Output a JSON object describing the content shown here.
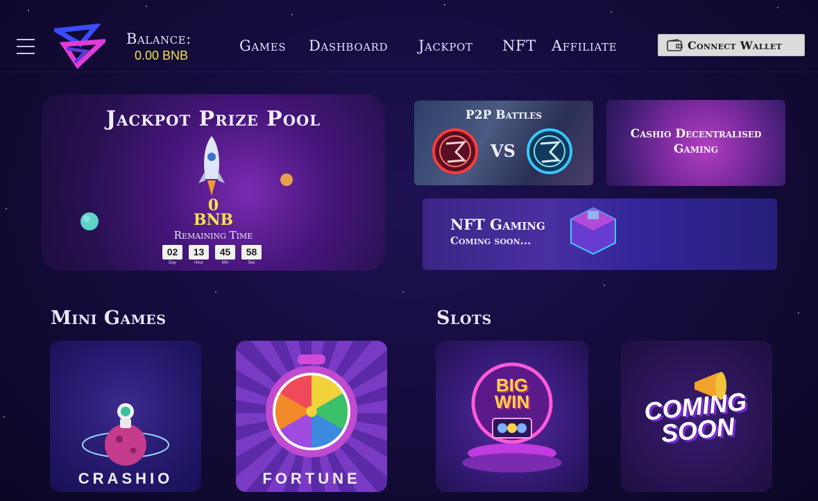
{
  "header": {
    "balance_label": "Balance:",
    "balance_value": "0.00 BNB",
    "nav": [
      "Games",
      "Dashboard",
      "Jackpot",
      "NFT",
      "Affiliate"
    ],
    "connect_label": "Connect Wallet"
  },
  "jackpot": {
    "title": "Jackpot Prize Pool",
    "amount": "0",
    "currency": "BNB",
    "remaining_label": "Remaining Time",
    "countdown": [
      {
        "value": "02",
        "unit": "Day"
      },
      {
        "value": "13",
        "unit": "Hour"
      },
      {
        "value": "45",
        "unit": "Min"
      },
      {
        "value": "58",
        "unit": "Sec"
      }
    ]
  },
  "promos": {
    "p2p_title": "P2P Battles",
    "p2p_vs": "VS",
    "cashio_line1": "Cashio Decentralised",
    "cashio_line2": "Gaming",
    "nft_title": "NFT Gaming",
    "nft_sub": "Coming soon..."
  },
  "sections": {
    "mini_games": "Mini Games",
    "slots": "Slots"
  },
  "games": {
    "crashio": "CRASHIO",
    "fortune": "FORTUNE",
    "big_win_line1": "BIG",
    "big_win_line2": "WIN",
    "coming_line1": "COMING",
    "coming_line2": "SOON"
  },
  "colors": {
    "background": "#150c3e",
    "accent_yellow": "#f2e24a",
    "text": "#e6e2ff"
  },
  "icons": [
    "menu-icon",
    "logo",
    "wallet-icon",
    "rocket-icon"
  ]
}
